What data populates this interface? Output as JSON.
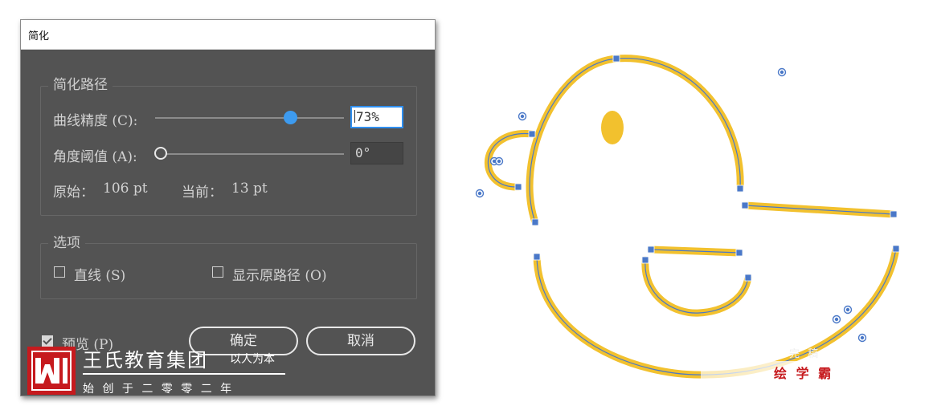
{
  "dialog": {
    "title": "简化",
    "simplify_path": {
      "group_title": "简化路径",
      "curve_precision_label": "曲线精度 (C):",
      "curve_precision_value": "73%",
      "curve_precision_level": 0.73,
      "angle_threshold_label": "角度阈值 (A):",
      "angle_threshold_value": "0°",
      "angle_threshold_level": 0,
      "original_label": "原始：",
      "original_value": "106 pt",
      "current_label": "当前：",
      "current_value": "13 pt"
    },
    "options": {
      "group_title": "选项",
      "straight_lines_label": "直线 (S)",
      "straight_lines_checked": false,
      "show_original_label": "显示原路径 (O)",
      "show_original_checked": false
    },
    "preview_label": "预览 (P)",
    "preview_checked": true,
    "ok_label": "确定",
    "cancel_label": "取消"
  },
  "watermark": {
    "brand_name": "王氏教育集团",
    "slogan": "以人为本",
    "founded": "始 创 于 二 零 零 二 年",
    "side_small": "完 稿",
    "side_label": "绘 学 霸"
  },
  "colors": {
    "dialog_bg": "#535353",
    "slider_accent": "#3d9bf0",
    "stroke_yellow": "#f2c12e",
    "path_blue": "#4a78c8",
    "brand_red": "#c61a1e"
  }
}
